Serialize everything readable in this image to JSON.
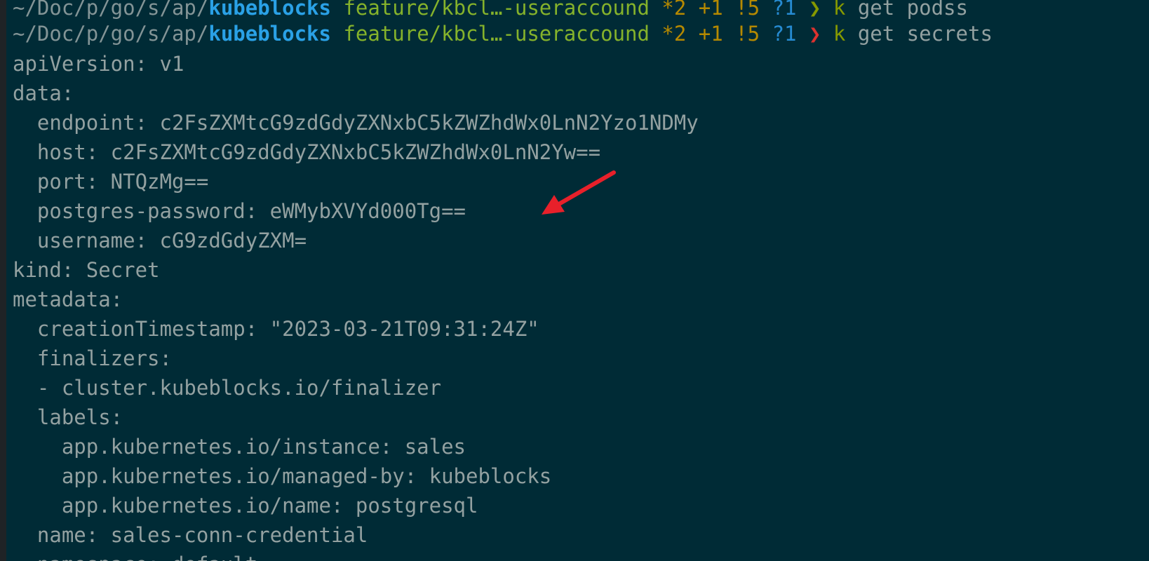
{
  "prompts": [
    {
      "path": "~/Doc/p/go/s/ap/",
      "repo": "kubeblocks",
      "branch": "feature/kbcl…-useraccound",
      "staged": "*2",
      "added": "+1",
      "modified": "!5",
      "untracked": "?1",
      "symbol": "❯",
      "cmd": "k",
      "args": "get podss"
    },
    {
      "path": "~/Doc/p/go/s/ap/",
      "repo": "kubeblocks",
      "branch": "feature/kbcl…-useraccound",
      "staged": "*2",
      "added": "+1",
      "modified": "!5",
      "untracked": "?1",
      "symbol": "❯",
      "cmd": "k",
      "args": "get secrets"
    }
  ],
  "output_lines": [
    "apiVersion: v1",
    "data:",
    "  endpoint: c2FsZXMtcG9zdGdyZXNxbC5kZWZhdWx0LnN2Yzo1NDMy",
    "  host: c2FsZXMtcG9zdGdyZXNxbC5kZWZhdWx0LnN2Yw==",
    "  port: NTQzMg==",
    "  postgres-password: eWMybXVYd000Tg==",
    "  username: cG9zdGdyZXM=",
    "kind: Secret",
    "metadata:",
    "  creationTimestamp: \"2023-03-21T09:31:24Z\"",
    "  finalizers:",
    "  - cluster.kubeblocks.io/finalizer",
    "  labels:",
    "    app.kubernetes.io/instance: sales",
    "    app.kubernetes.io/managed-by: kubeblocks",
    "    app.kubernetes.io/name: postgresql",
    "  name: sales-conn-credential",
    "  namespace: default"
  ],
  "colors": {
    "background": "#002b36",
    "text": "#93a1a1",
    "repo": "#2aa1e6",
    "branch": "#85b22b",
    "prompt_ok": "#859900",
    "prompt_err": "#dc322f",
    "annotation_arrow": "#e8202a"
  }
}
